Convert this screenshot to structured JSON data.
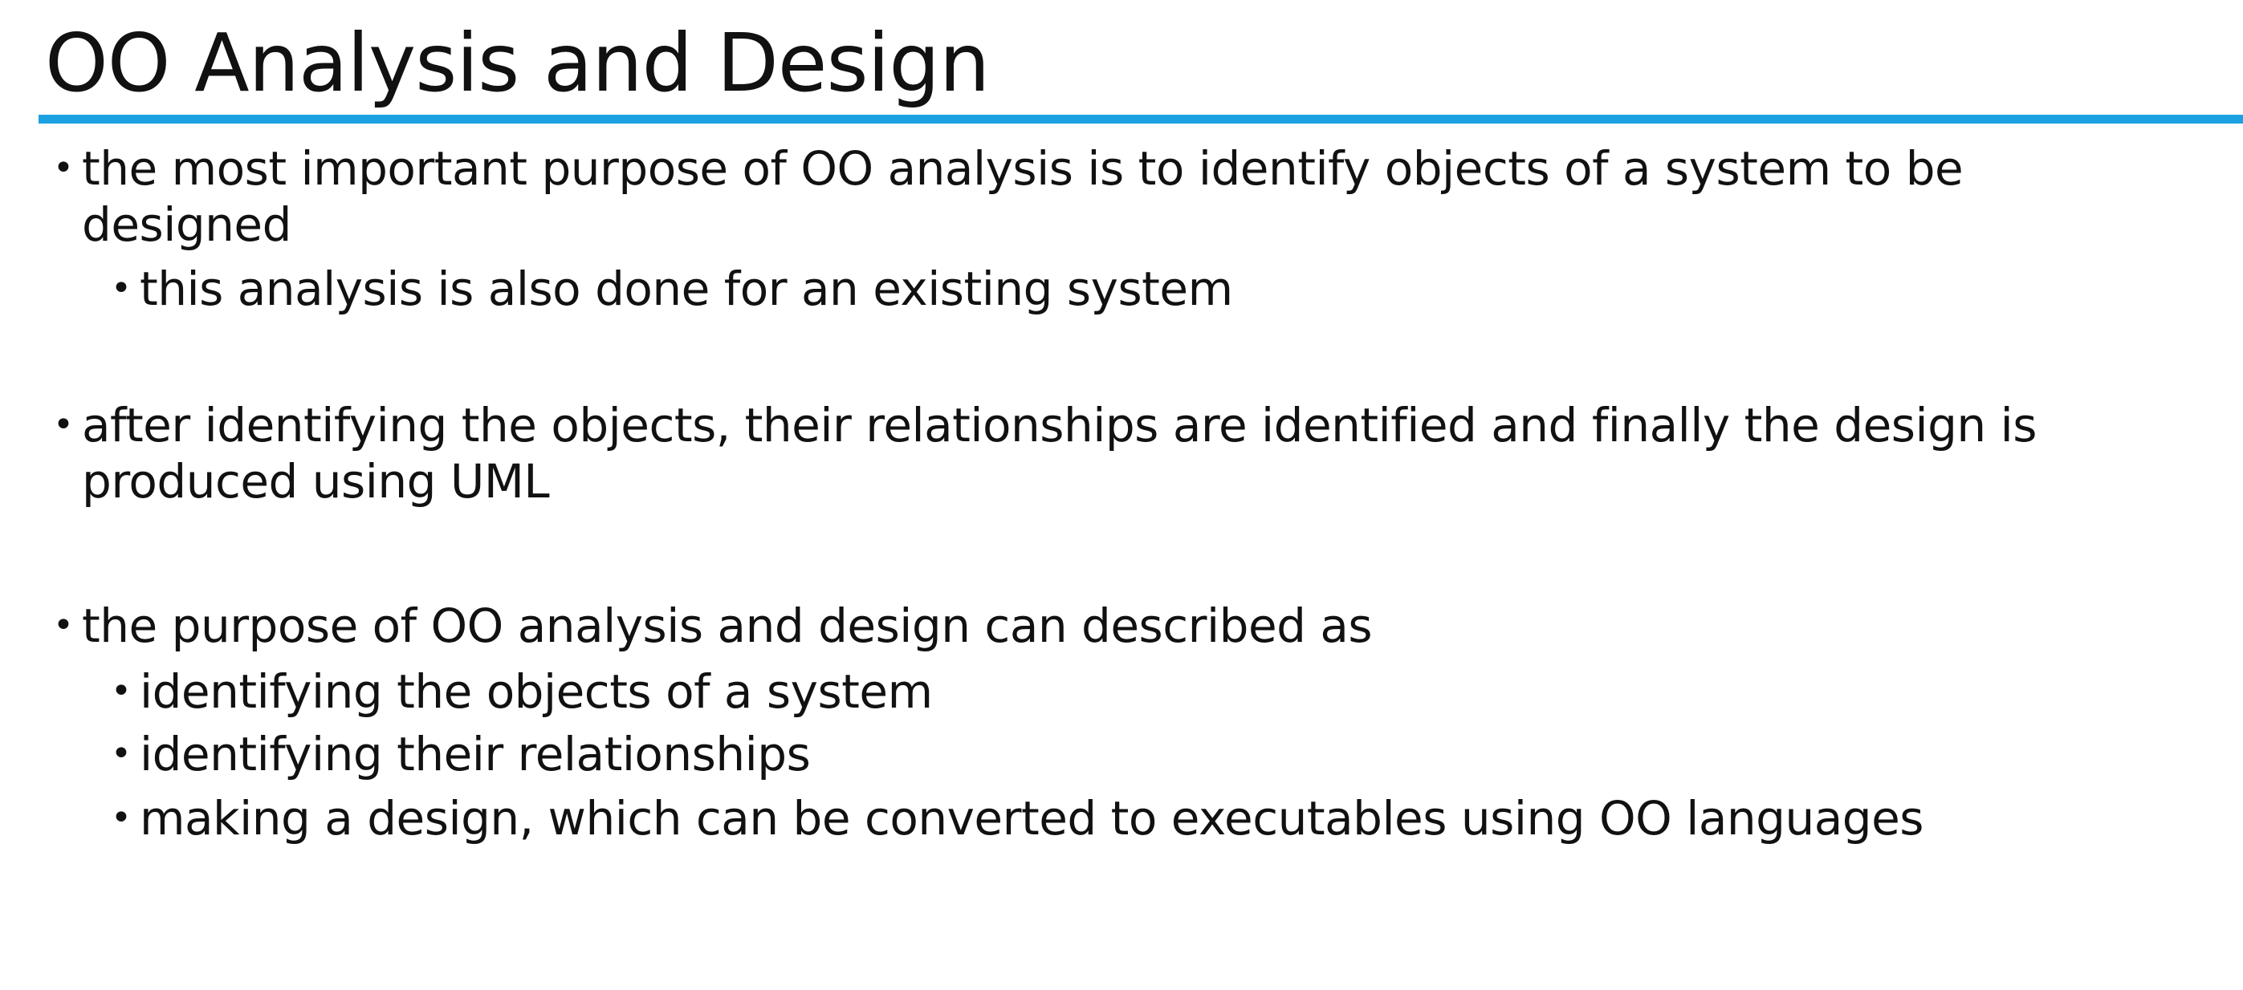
{
  "title": "OO Analysis and Design",
  "bullets": [
    {
      "line1": "the most important purpose of OO analysis is to identify objects of a system to be",
      "line2": "designed"
    },
    {
      "text": "this analysis is also done for an existing system"
    },
    {
      "line1": "after identifying the objects, their relationships are identified and finally the design is",
      "line2": "produced using UML"
    },
    {
      "text": "the purpose of OO analysis and design can described as"
    },
    {
      "text": "identifying the objects of a system"
    },
    {
      "text": "identifying their relationships"
    },
    {
      "text": "making a design, which can be converted to executables using OO languages"
    }
  ],
  "colors": {
    "accent_rule": "#1ba1e2",
    "text": "#111111",
    "background": "#ffffff"
  }
}
